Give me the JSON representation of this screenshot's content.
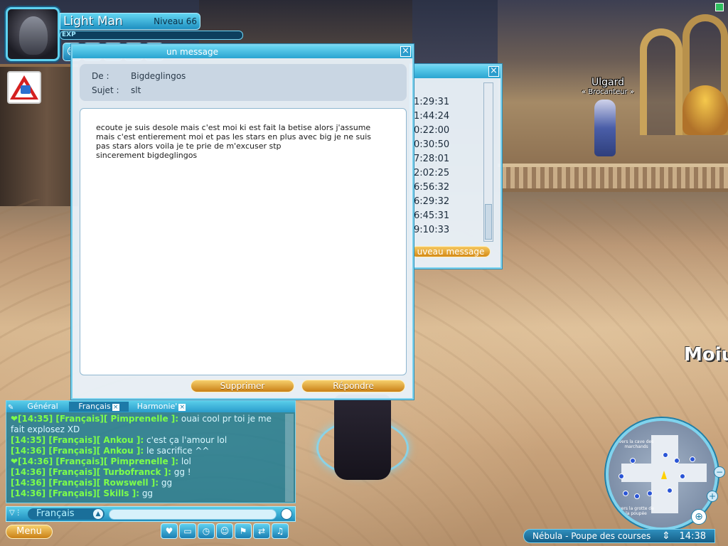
{
  "player": {
    "name": "Light Man",
    "level": "Niveau 66",
    "exp_label": "EXP"
  },
  "hud_icons": [
    "character-icon",
    "equipment-icon",
    "skills-icon",
    "journal-icon",
    "mail-icon"
  ],
  "world": {
    "npc_name": "Ulgard",
    "npc_title": "« Brocanteur »",
    "floating_name": "Moiu"
  },
  "mail_list": {
    "times": [
      "1:29:31",
      "1:44:24",
      "0:22:00",
      "0:30:50",
      "7:28:01",
      "2:02:25",
      "6:56:32",
      "6:29:32",
      "6:45:31",
      "9:10:33"
    ],
    "new_message_label": "uveau message"
  },
  "message": {
    "title": "un message",
    "from_label": "De :",
    "from_value": "Bigdeglingos",
    "subject_label": "Sujet :",
    "subject_value": "slt",
    "body": "ecoute je suis desole mais c'est moi ki est fait la betise alors j'assume\nmais c'est entierement moi et pas les stars en plus avec big je ne suis\npas stars alors voila je te prie de m'excuser stp\nsincerement bigdeglingos",
    "delete_label": "Supprimer",
    "reply_label": "Répondre"
  },
  "chat": {
    "tabs": [
      {
        "label": "Général"
      },
      {
        "label": "Français"
      },
      {
        "label": "Harmonie'"
      }
    ],
    "lines": [
      {
        "prefix": "❤[14:35] [Français][ Pimprenelle ]:",
        "text": " ouai cool pr toi je me fait explosez XD"
      },
      {
        "prefix": "[14:35] [Français][ Ankou ]:",
        "text": " c'est ça l'amour lol"
      },
      {
        "prefix": "[14:36] [Français][ Ankou ]:",
        "text": " le sacrifice ^^"
      },
      {
        "prefix": "❤[14:36] [Français][ Pimprenelle ]:",
        "text": " lol"
      },
      {
        "prefix": "[14:36] [Français][ Turbofranck ]:",
        "text": " gg !"
      },
      {
        "prefix": "[14:36] [Français][ Rowswell ]:",
        "text": " gg"
      },
      {
        "prefix": "[14:36] [Français][ Skills ]:",
        "text": " gg"
      }
    ],
    "channel": "Français"
  },
  "bottom_bar": {
    "menu_label": "Menu",
    "icons": [
      "heart-icon",
      "inventory-icon",
      "clock-icon",
      "friends-icon",
      "guild-icon",
      "trade-icon",
      "music-icon"
    ]
  },
  "minimap": {
    "label_top": "vers la cave des marchands",
    "label_bottom": "vers la grotte de la poupée"
  },
  "location": {
    "name": "Nébula - Poupe des courses",
    "time": "14:38"
  }
}
